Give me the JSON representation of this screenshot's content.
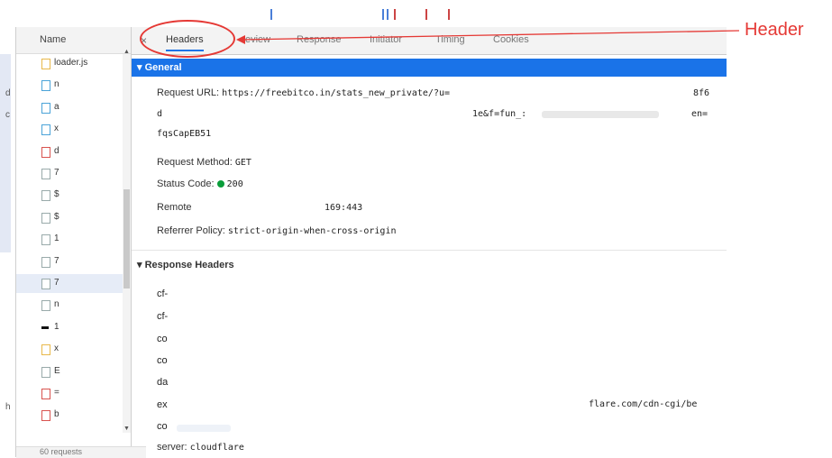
{
  "left_edge_chars": [
    "d",
    "c",
    "h"
  ],
  "request_list": {
    "header": "Name",
    "rows": [
      {
        "name": "loader.js",
        "icon": "js-file-icon"
      },
      {
        "name": "n",
        "icon": "doc-icon"
      },
      {
        "name": "a",
        "icon": "doc-icon"
      },
      {
        "name": "x",
        "icon": "doc-icon"
      },
      {
        "name": "d",
        "icon": "img-icon"
      },
      {
        "name": "7",
        "icon": "file-icon"
      },
      {
        "name": "$",
        "icon": "file-icon"
      },
      {
        "name": "$",
        "icon": "file-icon"
      },
      {
        "name": "1",
        "icon": "file-icon"
      },
      {
        "name": "7",
        "icon": "file-icon"
      },
      {
        "name": "7",
        "icon": "file-icon"
      },
      {
        "name": "n",
        "icon": "file-icon"
      },
      {
        "name": "1",
        "icon": "bar-icon"
      },
      {
        "name": "x",
        "icon": "js-file-icon"
      },
      {
        "name": "E",
        "icon": "file-icon"
      },
      {
        "name": "=",
        "icon": "img-icon"
      },
      {
        "name": "b",
        "icon": "img-icon"
      }
    ],
    "status": "60 requests"
  },
  "tabs": {
    "close": "×",
    "items": [
      "Headers",
      "Preview",
      "Response",
      "Initiator",
      "Timing",
      "Cookies"
    ],
    "visible_text": [
      "Headers",
      "eview",
      "Response",
      "Initiator",
      "Timing",
      "Cookies"
    ],
    "active": "Headers"
  },
  "general": {
    "title": "▾ General",
    "request_url_label": "Request URL:",
    "request_url_value": "https://freebitco.in/stats_new_private/?u=",
    "request_url_tail": "8f6",
    "line2_start": "d",
    "line2_mid": "1e&f=fun_:",
    "line2_end": "en=",
    "line3": "fqsCapEB51",
    "method_label": "Request Method:",
    "method_value": "GET",
    "status_label": "Status Code:",
    "status_value": "200",
    "status_color": "#0a9d3a",
    "remote_label": "Remote",
    "remote_value": "169:443",
    "referrer_label": "Referrer Policy:",
    "referrer_value": "strict-origin-when-cross-origin"
  },
  "response_headers": {
    "title": "▾ Response Headers",
    "keys": [
      "cf-",
      "cf-",
      "co",
      "co",
      "da",
      "ex",
      "co"
    ],
    "ex_value": "flare.com/cdn-cgi/be",
    "server_label": "server:",
    "server_value": "cloudflare"
  },
  "annotation": {
    "label": "Header",
    "color": "#e53935"
  },
  "colors": {
    "accent": "#1a73e8"
  }
}
